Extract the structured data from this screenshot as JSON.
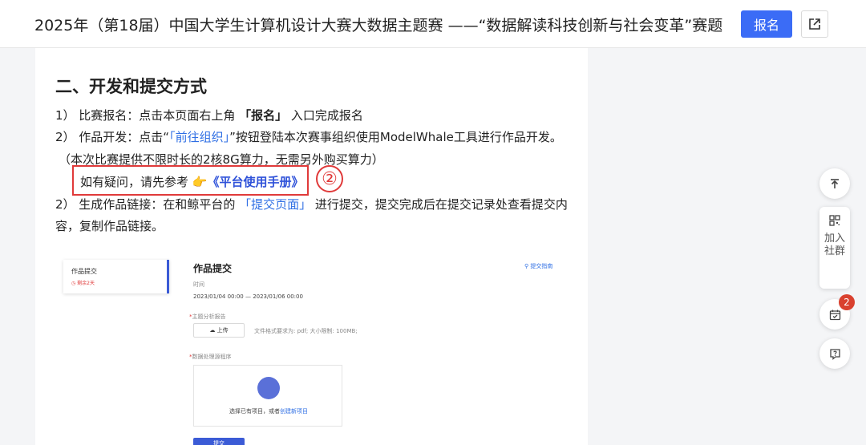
{
  "header": {
    "title": "2025年（第18届）中国大学生计算机设计大赛大数据主题赛 ——“数据解读科技创新与社会变革”赛题",
    "signup_label": "报名"
  },
  "article": {
    "section_title": "二、开发和提交方式",
    "line1": {
      "prefix": "1） 比赛报名：点击本页面右上角 ",
      "bold": "「报名」",
      "suffix": " 入口完成报名"
    },
    "line2": {
      "prefix": "2） 作品开发：点击“",
      "link": "「前往组织」",
      "suffix": "”按钮登陆本次赛事组织使用ModelWhale工具进行作品开发。"
    },
    "line3": "（本次比赛提供不限时长的2核8G算力，无需另外购买算力）",
    "hint": {
      "prefix": "如有疑问，请先参考 ",
      "emoji": "👉",
      "link": "《平台使用手册》"
    },
    "marker": "②",
    "line4": {
      "prefix": "2） 生成作品链接：在和鲸平台的 ",
      "link": "「提交页面」",
      "suffix": " 进行提交，提交完成后在提交记录处查看提交内"
    },
    "line5": "容，复制作品链接。"
  },
  "mock": {
    "card_title": "作品提交",
    "card_sub": "◷ 剩余2天",
    "heading": "作品提交",
    "guide": "提交指南",
    "time_label": "时间",
    "time_value": "2023/01/04 00:00 — 2023/01/06 00:00",
    "report_label": "主题分析报告",
    "upload_label": "上传",
    "format_hint": "文件格式要求为: pdf; 大小限制: 100MB;",
    "program_label": "数据处理源程序",
    "drop_prefix": "选择已有项目，或者",
    "drop_link": "创建新项目",
    "submit_label": "提交"
  },
  "sidebar": {
    "join_label": "加入社群",
    "badge_count": "2"
  },
  "icons": {
    "share": "share-icon",
    "top": "back-to-top-icon",
    "qrcode": "qrcode-icon",
    "calendar": "calendar-check-icon",
    "help": "help-icon"
  },
  "colors": {
    "primary": "#3b6cf6",
    "link": "#2f6fe4",
    "annotation_red": "#e03a3a",
    "badge_red": "#d9412f"
  }
}
